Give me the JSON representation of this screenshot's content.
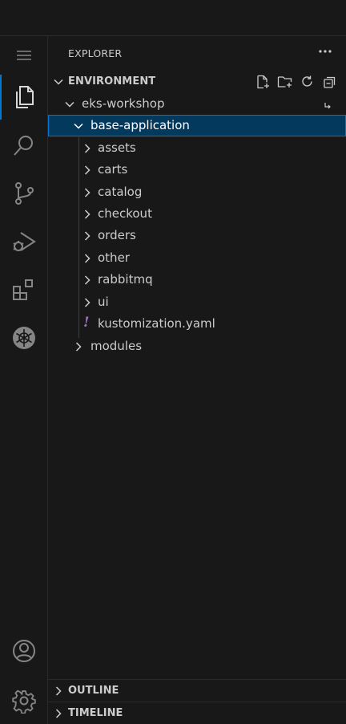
{
  "activity_bar": {
    "items": [
      {
        "name": "menu-icon"
      },
      {
        "name": "explorer-icon"
      },
      {
        "name": "search-icon"
      },
      {
        "name": "source-control-icon"
      },
      {
        "name": "run-debug-icon"
      },
      {
        "name": "extensions-icon"
      },
      {
        "name": "kubernetes-icon"
      },
      {
        "name": "account-icon"
      },
      {
        "name": "settings-gear-icon"
      }
    ],
    "accent": "#0078d4"
  },
  "sidebar": {
    "title": "EXPLORER",
    "more_icon": "ellipsis-icon",
    "section": {
      "title": "ENVIRONMENT",
      "actions": [
        "new-file-icon",
        "new-folder-icon",
        "refresh-icon",
        "collapse-all-icon"
      ]
    },
    "tree": {
      "root": "eks-workshop",
      "selected_folder": "base-application",
      "children": [
        "assets",
        "carts",
        "catalog",
        "checkout",
        "orders",
        "other",
        "rabbitmq",
        "ui"
      ],
      "file": "kustomization.yaml",
      "file_icon": "!",
      "sibling": "modules"
    },
    "bottom_sections": [
      "OUTLINE",
      "TIMELINE"
    ]
  },
  "colors": {
    "background": "#181818",
    "selection": "#04395e",
    "yaml_icon": "#a074c4"
  }
}
